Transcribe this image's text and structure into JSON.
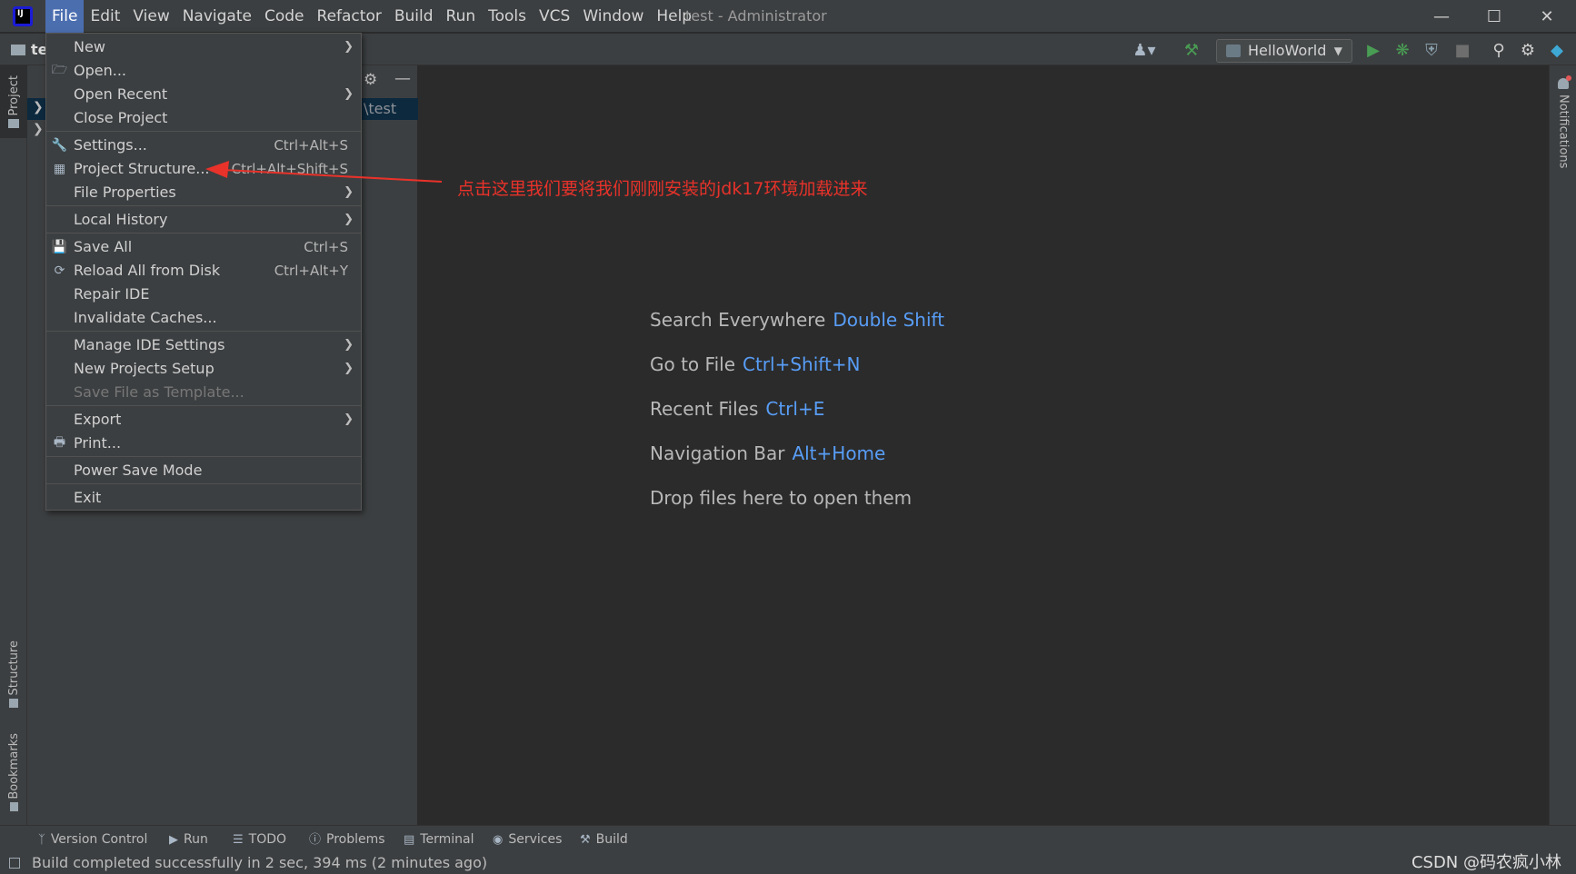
{
  "menubar": {
    "items": [
      "File",
      "Edit",
      "View",
      "Navigate",
      "Code",
      "Refactor",
      "Build",
      "Run",
      "Tools",
      "VCS",
      "Window",
      "Help"
    ],
    "active": "File"
  },
  "window": {
    "title": "test - Administrator"
  },
  "toolbar": {
    "project_name": "te",
    "run_config": "HelloWorld"
  },
  "left_tabs": {
    "project": "Project",
    "structure": "Structure",
    "bookmarks": "Bookmarks"
  },
  "right_tabs": {
    "notifications": "Notifications"
  },
  "project_tree": {
    "selected_path": "\\test"
  },
  "file_menu": {
    "items": [
      {
        "label": "New",
        "shortcut": "",
        "submenu": true,
        "icon": ""
      },
      {
        "label": "Open...",
        "shortcut": "",
        "submenu": false,
        "icon": "folder-open-icon"
      },
      {
        "label": "Open Recent",
        "shortcut": "",
        "submenu": true,
        "icon": ""
      },
      {
        "label": "Close Project",
        "shortcut": "",
        "submenu": false,
        "icon": ""
      },
      {
        "label": "Settings...",
        "shortcut": "Ctrl+Alt+S",
        "submenu": false,
        "icon": "wrench-icon"
      },
      {
        "label": "Project Structure...",
        "shortcut": "Ctrl+Alt+Shift+S",
        "submenu": false,
        "icon": "project-structure-icon"
      },
      {
        "label": "File Properties",
        "shortcut": "",
        "submenu": true,
        "icon": ""
      },
      {
        "label": "Local History",
        "shortcut": "",
        "submenu": true,
        "icon": ""
      },
      {
        "label": "Save All",
        "shortcut": "Ctrl+S",
        "submenu": false,
        "icon": "save-icon"
      },
      {
        "label": "Reload All from Disk",
        "shortcut": "Ctrl+Alt+Y",
        "submenu": false,
        "icon": "reload-icon"
      },
      {
        "label": "Repair IDE",
        "shortcut": "",
        "submenu": false,
        "icon": ""
      },
      {
        "label": "Invalidate Caches...",
        "shortcut": "",
        "submenu": false,
        "icon": ""
      },
      {
        "label": "Manage IDE Settings",
        "shortcut": "",
        "submenu": true,
        "icon": ""
      },
      {
        "label": "New Projects Setup",
        "shortcut": "",
        "submenu": true,
        "icon": ""
      },
      {
        "label": "Save File as Template...",
        "shortcut": "",
        "submenu": false,
        "icon": "",
        "disabled": true
      },
      {
        "label": "Export",
        "shortcut": "",
        "submenu": true,
        "icon": ""
      },
      {
        "label": "Print...",
        "shortcut": "",
        "submenu": false,
        "icon": "printer-icon"
      },
      {
        "label": "Power Save Mode",
        "shortcut": "",
        "submenu": false,
        "icon": ""
      },
      {
        "label": "Exit",
        "shortcut": "",
        "submenu": false,
        "icon": ""
      }
    ]
  },
  "annotation": {
    "text": "点击这里我们要将我们刚刚安装的jdk17环境加载进来",
    "color": "#e8322a"
  },
  "editor_hints": [
    {
      "label": "Search Everywhere",
      "key": "Double Shift"
    },
    {
      "label": "Go to File",
      "key": "Ctrl+Shift+N"
    },
    {
      "label": "Recent Files",
      "key": "Ctrl+E"
    },
    {
      "label": "Navigation Bar",
      "key": "Alt+Home"
    },
    {
      "label": "Drop files here to open them",
      "key": ""
    }
  ],
  "bottom_tools": [
    "Version Control",
    "Run",
    "TODO",
    "Problems",
    "Terminal",
    "Services",
    "Build"
  ],
  "status": {
    "message": "Build completed successfully in 2 sec, 394 ms (2 minutes ago)"
  },
  "watermark": "CSDN @码农疯小林",
  "colors": {
    "accent": "#4b6eaf",
    "key_hint": "#589df6",
    "run_green": "#499c54"
  }
}
